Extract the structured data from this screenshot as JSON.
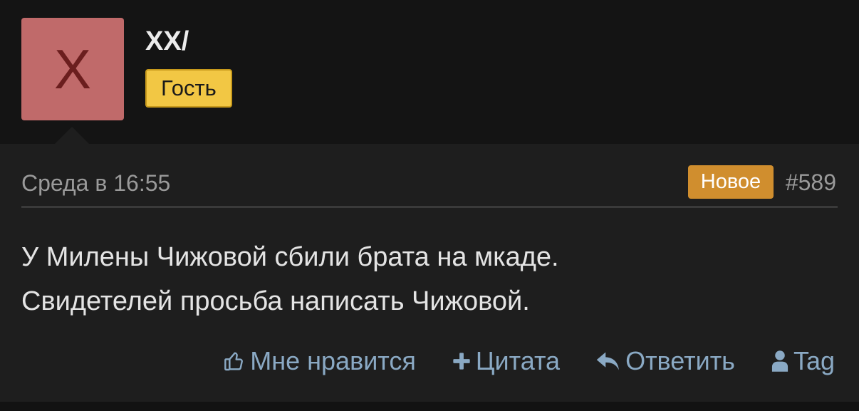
{
  "author": {
    "avatar_letter": "X",
    "name": "XX/",
    "role": "Гость"
  },
  "post": {
    "date": "Среда в 16:55",
    "new_label": "Новое",
    "number": "#589",
    "body_lines": [
      "У Милены Чижовой сбили брата на мкаде.",
      "Свидетелей просьба написать Чижовой."
    ]
  },
  "actions": {
    "like": "Мне нравится",
    "quote": "Цитата",
    "reply": "Ответить",
    "tag": "Tag"
  },
  "colors": {
    "avatar_bg": "#c06a6a",
    "role_badge": "#f2c744",
    "new_badge": "#d08e2e",
    "action_link": "#8aa9c4"
  },
  "icons": {
    "like": "thumbs-up-icon",
    "quote": "plus-icon",
    "reply": "reply-icon",
    "tag": "user-icon"
  }
}
